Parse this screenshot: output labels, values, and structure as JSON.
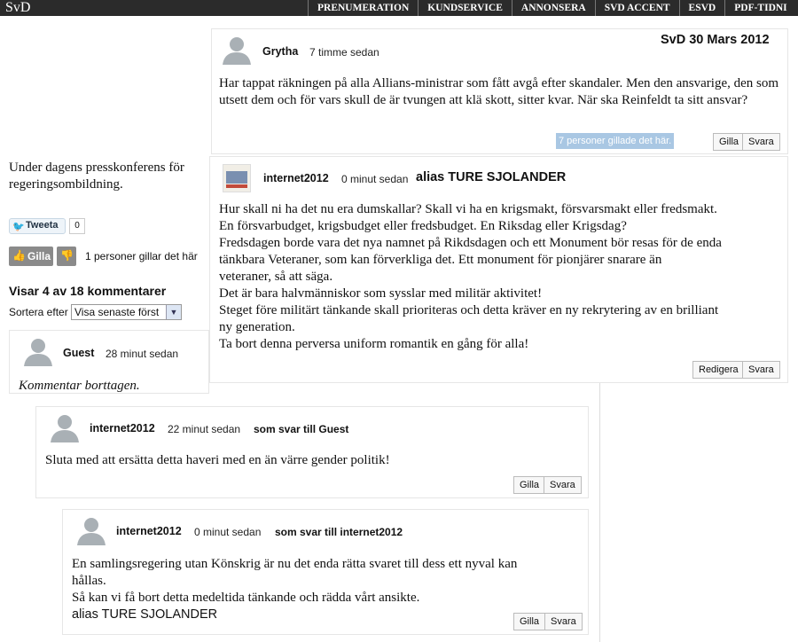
{
  "header": {
    "logo": "SvD",
    "nav": [
      "PRENUMERATION",
      "KUNDSERVICE",
      "ANNONSERA",
      "SVD ACCENT",
      "ESVD",
      "PDF-TIDNI"
    ]
  },
  "date_stamp": "SvD 30 Mars 2012",
  "left": {
    "article_text_1": "Under dagens presskonferens för",
    "article_text_2": "regeringsombildning.",
    "tweet_label": "Tweeta",
    "tweet_count": "0",
    "like_label": "Gilla",
    "likes_text": "1 personer gillar det här",
    "comments_heading": "Visar 4 av 18 kommentarer",
    "sort_label": "Sortera efter",
    "sort_value": "Visa senaste först"
  },
  "comments": [
    {
      "author": "Grytha",
      "time": "7 timme sedan",
      "body": "Har tappat räkningen på alla Allians-ministrar som fått avgå efter skandaler. Men den ansvarige, den som utsett dem och för vars skull de är tvungen att klä skott, sitter kvar. När ska Reinfeldt ta sitt ansvar?",
      "likes_badge": "7 personer gillade det här.",
      "btn_like": "Gilla",
      "btn_reply": "Svara"
    },
    {
      "author": "internet2012",
      "time": "0 minut sedan",
      "alias": "alias TURE SJOLANDER",
      "lines": [
        "Hur skall ni ha det nu era dumskallar? Skall vi ha en krigsmakt, försvarsmakt eller fredsmakt.",
        "En försvarbudget, krigsbudget eller fredsbudget. En Riksdag eller Krigsdag?",
        "Fredsdagen borde vara det nya namnet på Rikdsdagen och ett Monument bör resas för de enda",
        "tänkbara Veteraner, som kan förverkliga det. Ett monument för pionjärer snarare än",
        "veteraner, så att säga.",
        "Det är bara halvmänniskor som sysslar med militär aktivitet!",
        "Steget före militärt tänkande skall prioriteras och detta kräver en ny rekrytering av en brilliant",
        "ny generation.",
        "Ta bort denna perversa uniform romantik en gång för alla!"
      ],
      "btn_edit": "Redigera",
      "btn_reply": "Svara"
    },
    {
      "author": "Guest",
      "time": "28 minut sedan",
      "body": "Kommentar borttagen."
    },
    {
      "author": "internet2012",
      "time": "22 minut sedan",
      "reply_to": "som svar till Guest",
      "body": "Sluta med att ersätta detta haveri med en än värre gender politik!",
      "btn_like": "Gilla",
      "btn_reply": "Svara"
    },
    {
      "author": "internet2012",
      "time": "0 minut sedan",
      "reply_to": "som svar till internet2012",
      "lines": [
        "En samlingsregering utan Könskrig är nu det enda rätta svaret till dess ett nyval kan",
        "hållas.",
        "Så kan vi få bort detta medeltida tänkande och rädda vårt ansikte."
      ],
      "alias": "alias TURE SJOLANDER",
      "btn_like": "Gilla",
      "btn_reply": "Svara"
    }
  ]
}
